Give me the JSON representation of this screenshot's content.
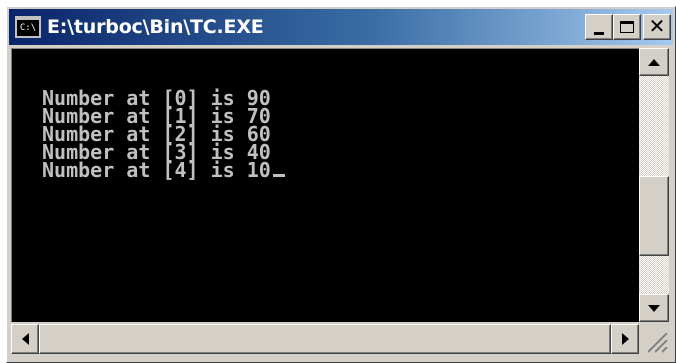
{
  "window": {
    "title": "E:\\turboc\\Bin\\TC.EXE",
    "icon_name": "console-icon",
    "icon_text": "C:\\"
  },
  "title_buttons": {
    "minimize_icon": "minimize-icon",
    "maximize_icon": "maximize-icon",
    "close_icon": "close-icon",
    "close_glyph": "✕"
  },
  "console": {
    "background": "#000000",
    "text_color": "#c0c0c0",
    "lines": [
      "Number at [0] is 90",
      "Number at [1] is 70",
      "Number at [2] is 60",
      "Number at [3] is 40",
      "Number at [4] is 10"
    ]
  },
  "scrollbars": {
    "vertical": {
      "up_icon": "arrow-up-icon",
      "down_icon": "arrow-down-icon"
    },
    "horizontal": {
      "left_icon": "arrow-left-icon",
      "right_icon": "arrow-right-icon"
    }
  }
}
